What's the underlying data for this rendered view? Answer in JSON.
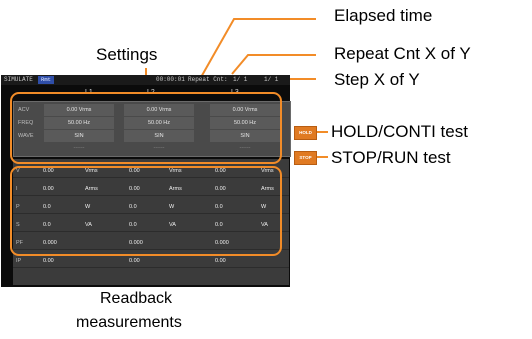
{
  "callouts": {
    "elapsed_time": "Elapsed time",
    "repeat_cnt": "Repeat Cnt X of Y",
    "step": "Step X of Y",
    "settings": "Settings",
    "hold_conti": "HOLD/CONTI test",
    "stop_run": "STOP/RUN test",
    "readback_line1": "Readback",
    "readback_line2": "measurements"
  },
  "status_bar": {
    "mode": "SIMULATE",
    "badge": "Rmt",
    "elapsed": "00:00:01",
    "repeat_label": "Repeat Cnt:",
    "repeat_value": "1/ 1",
    "step_value": "1/ 1"
  },
  "phases": [
    "L1",
    "L2",
    "L3"
  ],
  "settings_rows": [
    {
      "label": "ACV",
      "values": [
        "0.00 Vrms",
        "0.00 Vrms",
        "0.00 Vrms"
      ]
    },
    {
      "label": "FREQ",
      "values": [
        "50.00 Hz",
        "50.00 Hz",
        "50.00 Hz"
      ]
    },
    {
      "label": "WAVE",
      "values": [
        "SIN",
        "SIN",
        "SIN"
      ]
    },
    {
      "label": "",
      "values": [
        "------",
        "------",
        "------"
      ]
    }
  ],
  "readback_rows": [
    {
      "label": "V",
      "cells": [
        [
          "0.00",
          "Vrms"
        ],
        [
          "0.00",
          "Vrms"
        ],
        [
          "0.00",
          "Vrms"
        ]
      ]
    },
    {
      "label": "I",
      "cells": [
        [
          "0.00",
          "Arms"
        ],
        [
          "0.00",
          "Arms"
        ],
        [
          "0.00",
          "Arms"
        ]
      ]
    },
    {
      "label": "P",
      "cells": [
        [
          "0.0",
          "W"
        ],
        [
          "0.0",
          "W"
        ],
        [
          "0.0",
          "W"
        ]
      ]
    },
    {
      "label": "S",
      "cells": [
        [
          "0.0",
          "VA"
        ],
        [
          "0.0",
          "VA"
        ],
        [
          "0.0",
          "VA"
        ]
      ]
    },
    {
      "label": "PF",
      "cells": [
        [
          "0.000",
          ""
        ],
        [
          "0.000",
          ""
        ],
        [
          "0.000",
          ""
        ]
      ]
    },
    {
      "label": "IP",
      "cells": [
        [
          "0.00",
          ""
        ],
        [
          "0.00",
          ""
        ],
        [
          "0.00",
          ""
        ]
      ]
    }
  ],
  "softkeys": {
    "hold": "HOLD",
    "stop": "STOP"
  },
  "colors": {
    "accent_orange": "#f28c28",
    "screen_bg": "#0b0b0b"
  }
}
